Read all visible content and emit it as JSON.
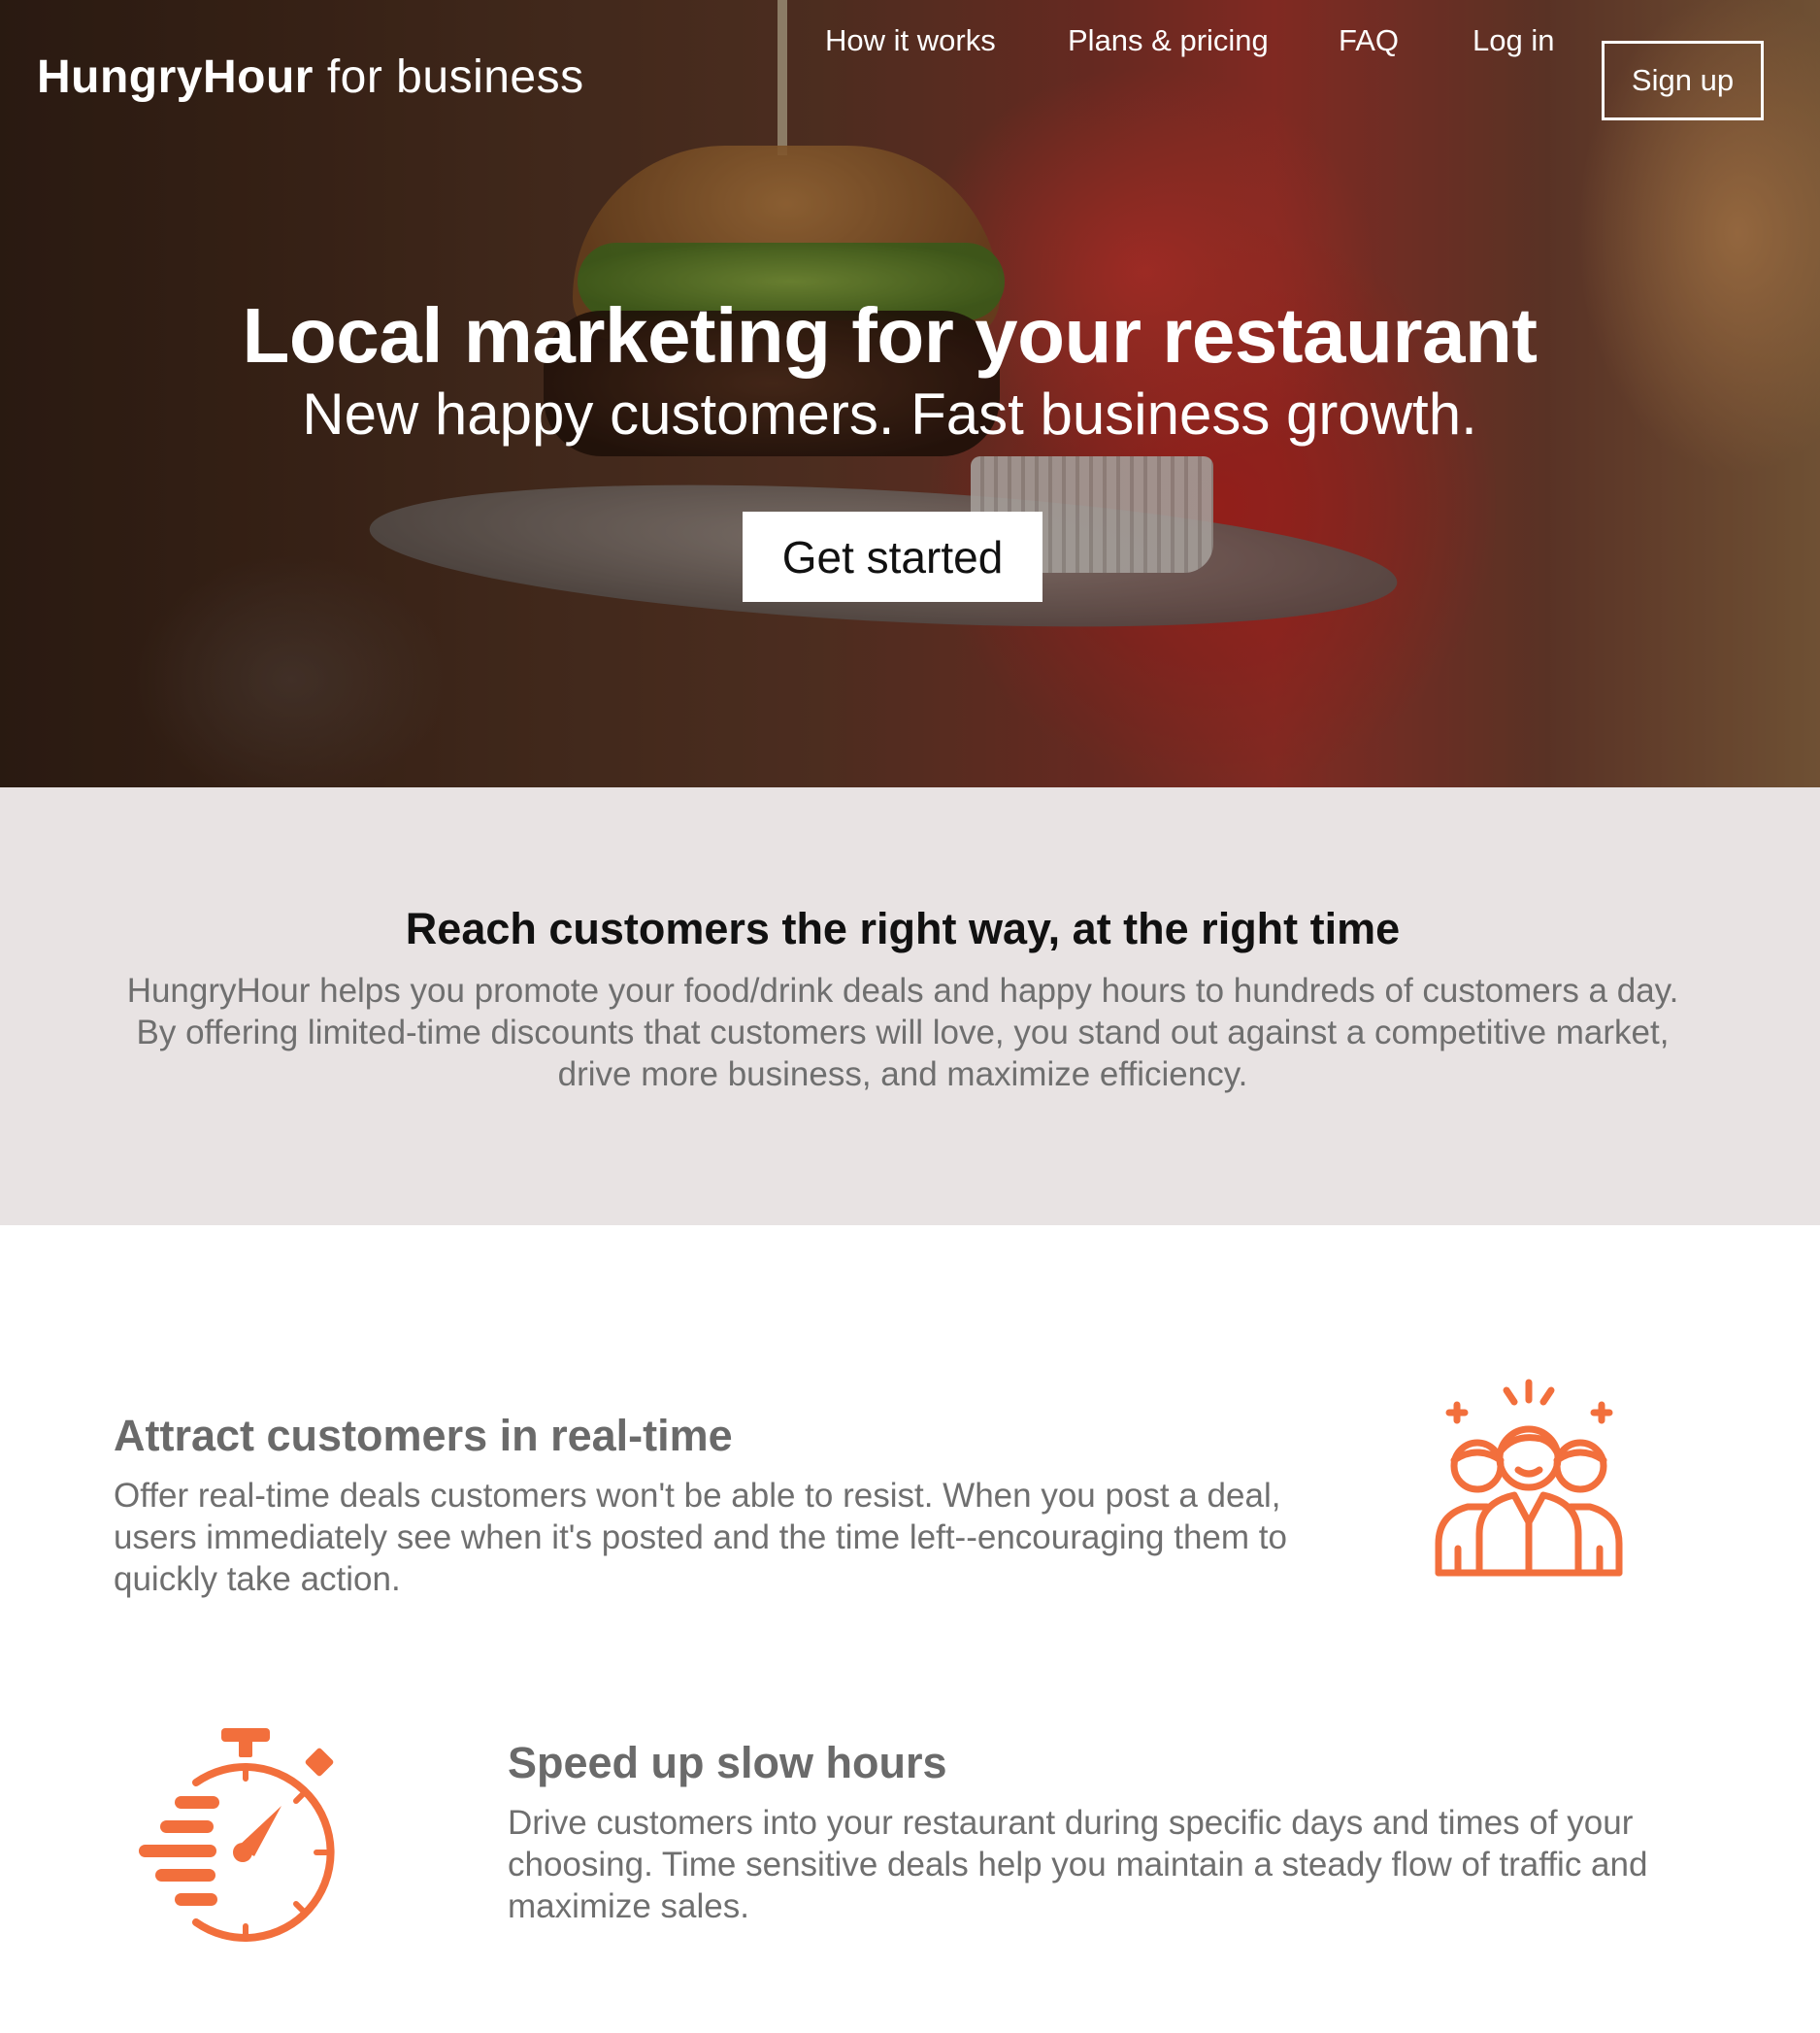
{
  "nav": {
    "brand_strong": "HungryHour",
    "brand_rest": " for business",
    "links": [
      "How it works",
      "Plans & pricing",
      "FAQ",
      "Log in"
    ],
    "signup_label": "Sign up"
  },
  "hero": {
    "title": "Local marketing for your restaurant",
    "subtitle": "New happy customers. Fast business growth.",
    "cta_label": "Get started"
  },
  "intro": {
    "heading": "Reach customers the right way, at the right time",
    "body": "HungryHour helps you promote your food/drink deals and happy hours to hundreds of customers a day. By offering limited-time discounts that customers will love, you stand out against a competitive market, drive more business, and maximize efficiency."
  },
  "features": [
    {
      "title": "Attract customers in real-time",
      "body": "Offer real-time deals customers won't be able to resist. When you post a deal, users immediately see when it's posted and the time left--encouraging them to quickly take action.",
      "icon": "customers-group-icon"
    },
    {
      "title": "Speed up slow hours",
      "body": "Drive customers into your restaurant during specific days and times of your choosing. Time sensitive deals help you maintain a steady flow of traffic and maximize sales.",
      "icon": "stopwatch-icon"
    }
  ],
  "colors": {
    "accent": "#f26f3c",
    "intro_bg": "#e8e3e3",
    "text_gray": "#6f6f6f"
  }
}
